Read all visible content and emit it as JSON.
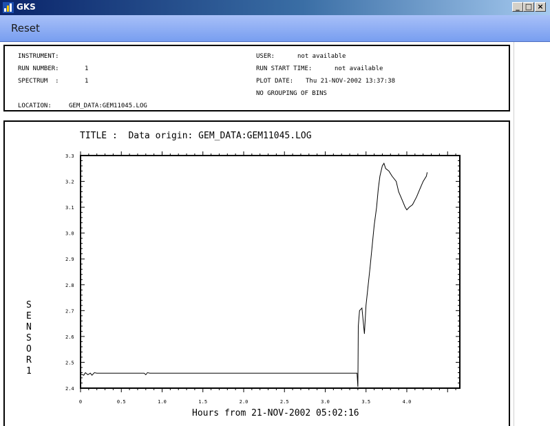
{
  "window": {
    "title": "GKS",
    "minimize_glyph": "_",
    "maximize_glyph": "□",
    "close_glyph": "×"
  },
  "toolbar": {
    "reset_label": "Reset"
  },
  "info": {
    "instrument_label": "INSTRUMENT:",
    "instrument_value": "",
    "run_number_label": "RUN NUMBER:",
    "run_number_value": "1",
    "spectrum_label": "SPECTRUM  :",
    "spectrum_value": "1",
    "location_label": "LOCATION:",
    "location_value": "GEM_DATA:GEM11045.LOG",
    "user_label": "USER:",
    "user_value": "not available",
    "run_start_label": "RUN START TIME:",
    "run_start_value": "not available",
    "plot_date_label": "PLOT DATE:",
    "plot_date_value": "Thu 21-NOV-2002 13:37:38",
    "grouping_text": "NO GROUPING OF BINS"
  },
  "chart_data": {
    "type": "line",
    "title": "TITLE :  Data origin: GEM_DATA:GEM11045.LOG",
    "xlabel": "Hours from 21-NOV-2002 05:02:16",
    "ylabel": "SENSOR1",
    "xlim": [
      0,
      4.65
    ],
    "ylim": [
      2.4,
      3.3
    ],
    "x_ticks": [
      "0",
      "0.5",
      "1.0",
      "1.5",
      "2.0",
      "2.5",
      "3.0",
      "3.5",
      "4.0"
    ],
    "y_ticks": [
      "2.4",
      "2.5",
      "2.6",
      "2.7",
      "2.8",
      "2.9",
      "3.0",
      "3.1",
      "3.2",
      "3.3"
    ],
    "grid": false,
    "series": [
      {
        "color": "#000000",
        "x": [
          0,
          0.04,
          0.06,
          0.09,
          0.12,
          0.14,
          0.17,
          0.2,
          0.5,
          0.78,
          0.8,
          0.82,
          0.85,
          1.5,
          2.5,
          3.0,
          3.39,
          3.395,
          3.4,
          3.405,
          3.42,
          3.45,
          3.48,
          3.5,
          3.52,
          3.55,
          3.6,
          3.63,
          3.65,
          3.67,
          3.7,
          3.72,
          3.74,
          3.78,
          3.82,
          3.87,
          3.9,
          3.94,
          3.98,
          4.0,
          4.03,
          4.07,
          4.12,
          4.16,
          4.2,
          4.24,
          4.25
        ],
        "values": [
          2.455,
          2.45,
          2.46,
          2.452,
          2.458,
          2.45,
          2.46,
          2.458,
          2.458,
          2.458,
          2.452,
          2.46,
          2.458,
          2.458,
          2.458,
          2.458,
          2.458,
          2.43,
          2.405,
          2.64,
          2.7,
          2.71,
          2.61,
          2.72,
          2.78,
          2.87,
          3.03,
          3.1,
          3.17,
          3.22,
          3.26,
          3.27,
          3.25,
          3.24,
          3.22,
          3.2,
          3.16,
          3.13,
          3.1,
          3.09,
          3.1,
          3.11,
          3.14,
          3.17,
          3.2,
          3.22,
          3.235
        ]
      }
    ]
  }
}
